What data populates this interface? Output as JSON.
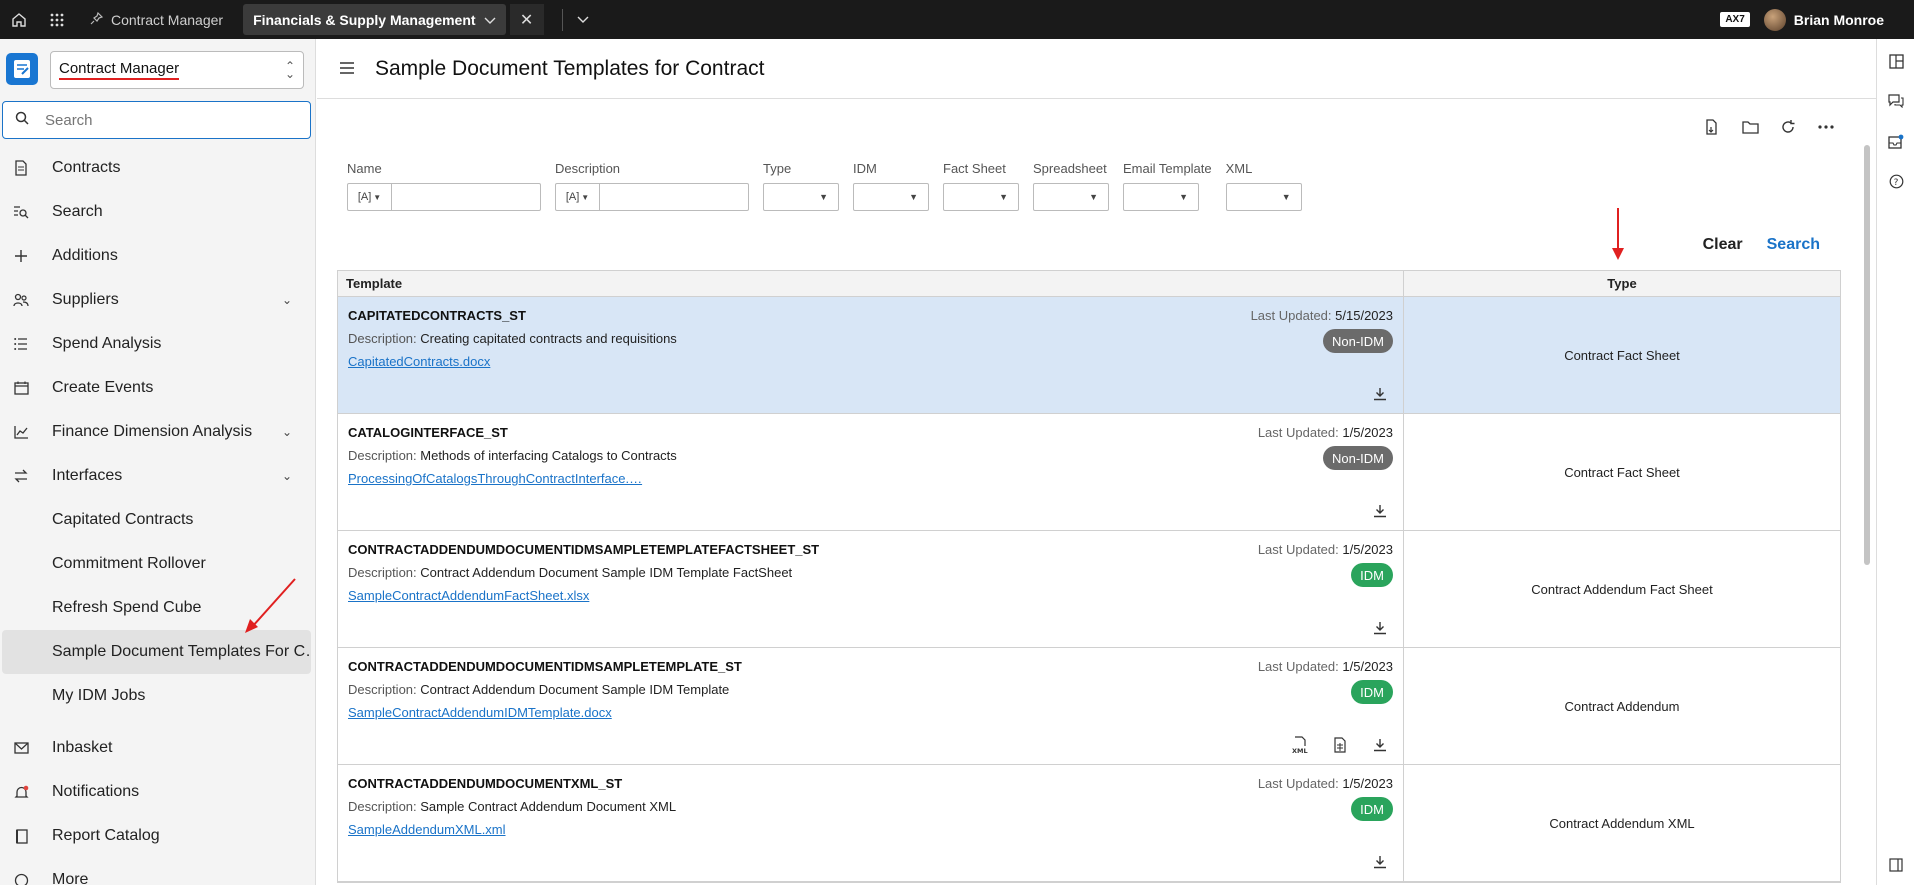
{
  "topbar": {
    "tabs": [
      {
        "label": "Contract Manager"
      },
      {
        "label": "Financials & Supply Management"
      }
    ],
    "badge": "AX7",
    "user_name": "Brian Monroe"
  },
  "sidebar": {
    "app_selector": "Contract Manager",
    "search_placeholder": "Search",
    "items": [
      {
        "label": "Contracts",
        "icon": "contracts-icon"
      },
      {
        "label": "Search",
        "icon": "search-list-icon"
      },
      {
        "label": "Additions",
        "icon": "plus-icon"
      },
      {
        "label": "Suppliers",
        "icon": "suppliers-icon"
      },
      {
        "label": "Spend Analysis",
        "icon": "list-icon"
      },
      {
        "label": "Create Events",
        "icon": "calendar-icon"
      },
      {
        "label": "Finance Dimension Analysis",
        "icon": "chart-icon"
      },
      {
        "label": "Interfaces",
        "icon": "swap-icon"
      }
    ],
    "interfaces_children": [
      {
        "label": "Capitated Contracts"
      },
      {
        "label": "Commitment Rollover"
      },
      {
        "label": "Refresh Spend Cube"
      },
      {
        "label": "Sample Document Templates For C…"
      },
      {
        "label": "My IDM Jobs"
      }
    ],
    "bottom_items": [
      {
        "label": "Inbasket",
        "icon": "mail-icon"
      },
      {
        "label": "Notifications",
        "icon": "bell-icon"
      },
      {
        "label": "Report Catalog",
        "icon": "book-icon"
      },
      {
        "label": "More",
        "icon": "more-icon"
      }
    ]
  },
  "main": {
    "title": "Sample Document Templates for Contract",
    "filters": {
      "name_label": "Name",
      "name_op": "[A]",
      "description_label": "Description",
      "description_op": "[A]",
      "type_label": "Type",
      "idm_label": "IDM",
      "fact_sheet_label": "Fact Sheet",
      "spreadsheet_label": "Spreadsheet",
      "email_template_label": "Email Template",
      "xml_label": "XML"
    },
    "actions": {
      "clear": "Clear",
      "search": "Search"
    },
    "table": {
      "col_template": "Template",
      "col_type": "Type",
      "last_updated_label": "Last Updated:",
      "description_label": "Description:",
      "rows": [
        {
          "name": "CAPITATEDCONTRACTS_ST",
          "description": "Creating capitated contracts and requisitions",
          "file": "CapitatedContracts.docx",
          "last_updated": "5/15/2023",
          "badge": "Non-IDM",
          "type": "Contract Fact Sheet"
        },
        {
          "name": "CATALOGINTERFACE_ST",
          "description": "Methods of interfacing Catalogs to Contracts",
          "file": "ProcessingOfCatalogsThroughContractInterface.…",
          "last_updated": "1/5/2023",
          "badge": "Non-IDM",
          "type": "Contract Fact Sheet"
        },
        {
          "name": "CONTRACTADDENDUMDOCUMENTIDMSAMPLETEMPLATEFACTSHEET_ST",
          "description": "Contract Addendum Document Sample IDM Template FactSheet",
          "file": "SampleContractAddendumFactSheet.xlsx",
          "last_updated": "1/5/2023",
          "badge": "IDM",
          "type": "Contract Addendum Fact Sheet"
        },
        {
          "name": "CONTRACTADDENDUMDOCUMENTIDMSAMPLETEMPLATE_ST",
          "description": "Contract Addendum Document Sample IDM Template",
          "file": "SampleContractAddendumIDMTemplate.docx",
          "last_updated": "1/5/2023",
          "badge": "IDM",
          "type": "Contract Addendum"
        },
        {
          "name": "CONTRACTADDENDUMDOCUMENTXML_ST",
          "description": "Sample Contract Addendum Document XML",
          "file": "SampleAddendumXML.xml",
          "last_updated": "1/5/2023",
          "badge": "IDM",
          "type": "Contract Addendum XML"
        }
      ]
    }
  },
  "colors": {
    "accent": "#1a73c8",
    "selected_row": "#d8e6f6",
    "idm_badge": "#2aa45c",
    "nonidm_badge": "#6b6b6b",
    "annotation_red": "#e02020"
  }
}
